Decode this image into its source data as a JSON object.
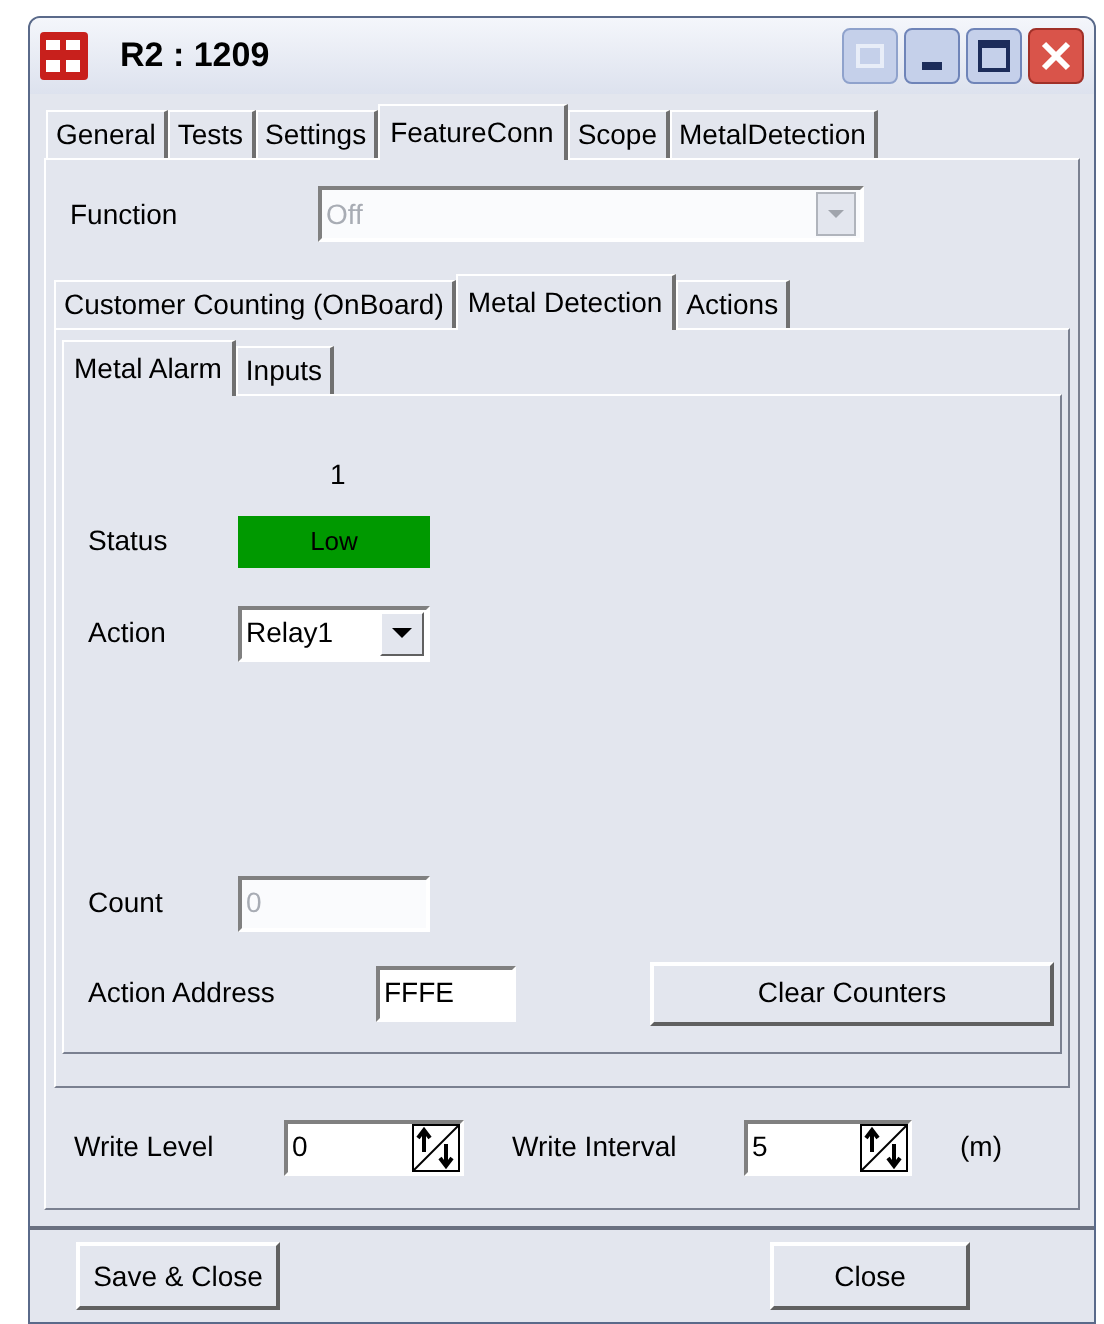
{
  "window": {
    "title": "R2 : 1209"
  },
  "tabs": [
    {
      "label": "General",
      "selected": false
    },
    {
      "label": "Tests",
      "selected": false
    },
    {
      "label": "Settings",
      "selected": false
    },
    {
      "label": "FeatureConn",
      "selected": true
    },
    {
      "label": "Scope",
      "selected": false
    },
    {
      "label": "MetalDetection",
      "selected": false
    }
  ],
  "function": {
    "label": "Function",
    "value": "Off",
    "disabled": true
  },
  "sub_tabs": [
    {
      "label": "Customer Counting (OnBoard)",
      "selected": false
    },
    {
      "label": "Metal Detection",
      "selected": true
    },
    {
      "label": "Actions",
      "selected": false
    }
  ],
  "inner_tabs": [
    {
      "label": "Metal Alarm",
      "selected": true
    },
    {
      "label": "Inputs",
      "selected": false
    }
  ],
  "metal_alarm": {
    "column_header": "1",
    "status": {
      "label": "Status",
      "value": "Low",
      "color": "#009900"
    },
    "action": {
      "label": "Action",
      "value": "Relay1"
    },
    "count": {
      "label": "Count",
      "value": "0",
      "disabled": true
    },
    "action_address": {
      "label": "Action Address",
      "value": "FFFE"
    },
    "clear_button": "Clear Counters"
  },
  "write_level": {
    "label": "Write Level",
    "value": "0"
  },
  "write_interval": {
    "label": "Write Interval",
    "value": "5",
    "unit": "(m)"
  },
  "buttons": [
    "Save & Close",
    "Close"
  ]
}
